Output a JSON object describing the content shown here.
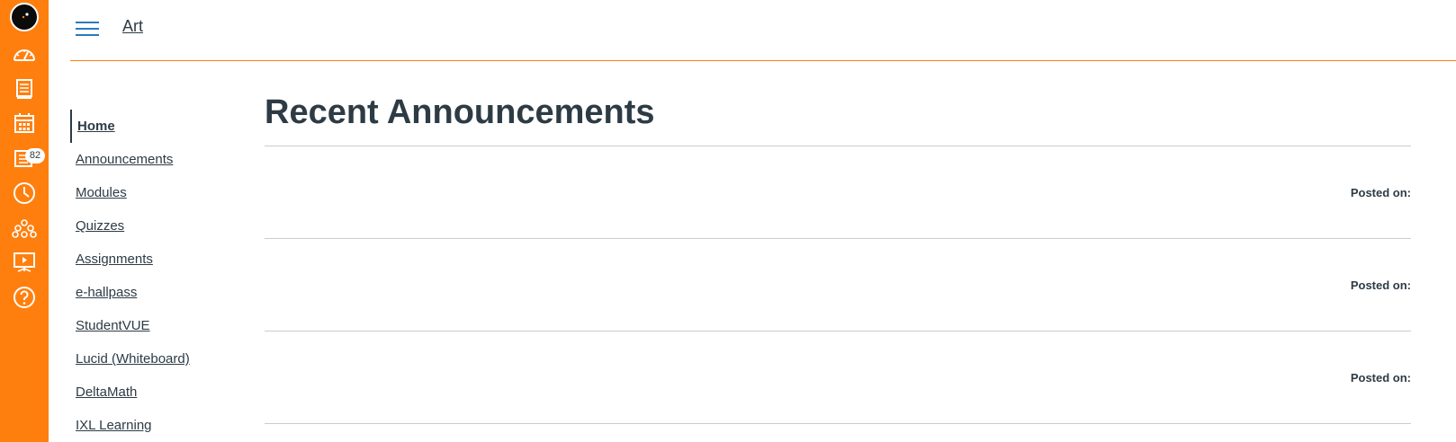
{
  "header": {
    "breadcrumb": "Art"
  },
  "global_nav": {
    "items": [
      {
        "icon": "dashboard-icon"
      },
      {
        "icon": "courses-icon"
      },
      {
        "icon": "calendar-icon"
      },
      {
        "icon": "inbox-icon",
        "badge": "82"
      },
      {
        "icon": "history-icon"
      },
      {
        "icon": "commons-icon"
      },
      {
        "icon": "studio-icon"
      },
      {
        "icon": "help-icon"
      }
    ],
    "accent_color": "#ff7f0e"
  },
  "course_nav": {
    "items": [
      {
        "label": "Home",
        "active": true
      },
      {
        "label": "Announcements"
      },
      {
        "label": "Modules"
      },
      {
        "label": "Quizzes"
      },
      {
        "label": "Assignments"
      },
      {
        "label": "e-hallpass"
      },
      {
        "label": "StudentVUE"
      },
      {
        "label": "Lucid (Whiteboard)"
      },
      {
        "label": "DeltaMath"
      },
      {
        "label": "IXL Learning"
      }
    ]
  },
  "main": {
    "title": "Recent Announcements",
    "announcements": [
      {
        "posted_label": "Posted on:"
      },
      {
        "posted_label": "Posted on:"
      },
      {
        "posted_label": "Posted on:"
      }
    ]
  }
}
